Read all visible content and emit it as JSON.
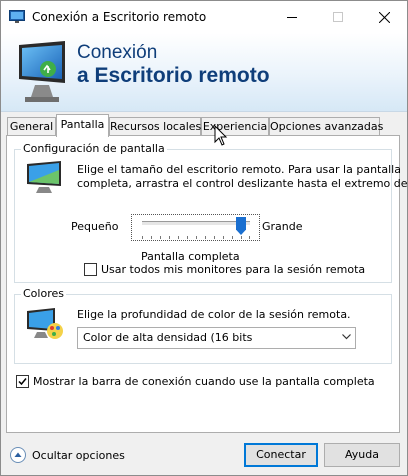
{
  "window": {
    "title": "Conexión a Escritorio remoto"
  },
  "banner": {
    "line1": "Conexión",
    "line2": "a Escritorio remoto"
  },
  "tabs": [
    {
      "label": "General"
    },
    {
      "label": "Pantalla"
    },
    {
      "label": "Recursos locales"
    },
    {
      "label": "Experiencia"
    },
    {
      "label": "Opciones avanzadas"
    }
  ],
  "active_tab": "Pantalla",
  "display_group": {
    "title": "Configuración de pantalla",
    "description_line1": "Elige el tamaño del escritorio remoto. Para usar la pantalla",
    "description_line2": "completa, arrastra el control deslizante hasta el extremo derecho.",
    "slider_min_label": "Pequeño",
    "slider_max_label": "Grande",
    "slider_value_label": "Pantalla completa",
    "slider_position": 1.0,
    "all_monitors_label": "Usar todos mis monitores para la sesión remota",
    "all_monitors_checked": false
  },
  "colors_group": {
    "title": "Colores",
    "description": "Elige la profundidad de color de la sesión remota.",
    "selected_depth": "Color de alta densidad (16 bits"
  },
  "connection_bar": {
    "label": "Mostrar la barra de conexión cuando use la pantalla completa",
    "checked": true
  },
  "footer": {
    "hide_options_label": "Ocultar opciones",
    "connect_label": "Conectar",
    "help_label": "Ayuda"
  },
  "colors": {
    "accent": "#0078d7",
    "banner_text": "#0f3e7a",
    "slider_thumb": "#1a6fd0"
  }
}
